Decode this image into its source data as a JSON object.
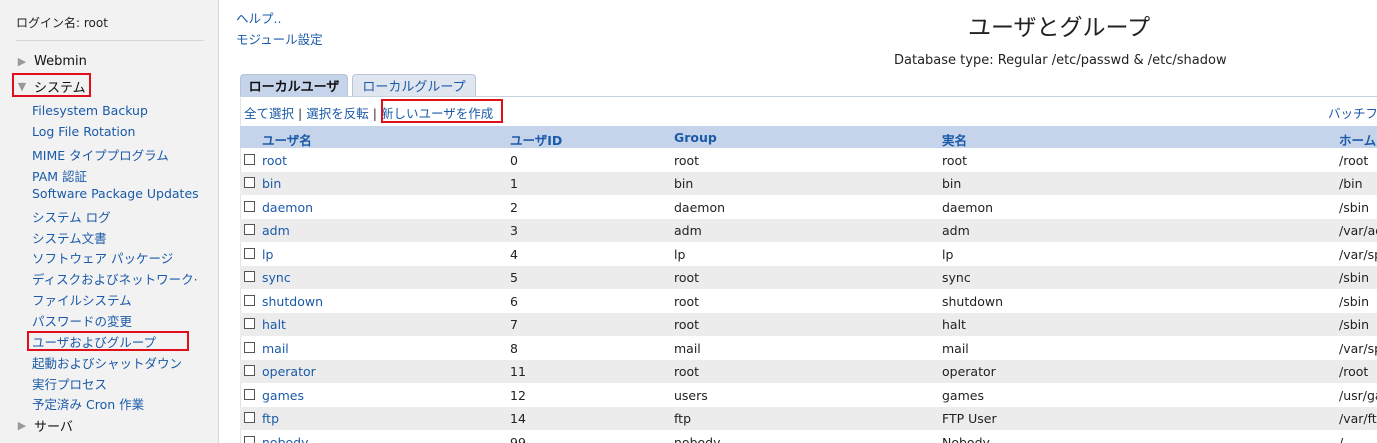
{
  "sidebar": {
    "login": "ログイン名: root",
    "categories": {
      "webmin": "Webmin",
      "system": "システム",
      "server": "サーバ"
    },
    "system_items": [
      "Filesystem Backup",
      "Log File Rotation",
      "MIME タイププログラム",
      "PAM 認証",
      "Software Package Updates",
      "システム ログ",
      "システム文書",
      "ソフトウェア パッケージ",
      "ディスクおよびネットワーク·",
      "ファイルシステム",
      "パスワードの変更",
      "ユーザおよびグループ",
      "起動およびシャットダウン",
      "実行プロセス",
      "予定済み Cron 作業"
    ]
  },
  "header": {
    "help": "ヘルプ..",
    "module_config": "モジュール設定",
    "title": "ユーザとグループ",
    "db_type": "Database type: Regular /etc/passwd & /etc/shadow"
  },
  "tabs": {
    "local_users": "ローカルユーザ",
    "local_groups": "ローカルグループ"
  },
  "actions": {
    "select_all": "全て選択",
    "invert": "選択を反転",
    "create": "新しいユーザを作成",
    "batch": "バッチフ"
  },
  "table": {
    "headers": {
      "name": "ユーザ名",
      "uid": "ユーザID",
      "group": "Group",
      "real": "実名",
      "home": "ホーム"
    },
    "rows": [
      {
        "name": "root",
        "uid": "0",
        "group": "root",
        "real": "root",
        "home": "/root"
      },
      {
        "name": "bin",
        "uid": "1",
        "group": "bin",
        "real": "bin",
        "home": "/bin"
      },
      {
        "name": "daemon",
        "uid": "2",
        "group": "daemon",
        "real": "daemon",
        "home": "/sbin"
      },
      {
        "name": "adm",
        "uid": "3",
        "group": "adm",
        "real": "adm",
        "home": "/var/ad"
      },
      {
        "name": "lp",
        "uid": "4",
        "group": "lp",
        "real": "lp",
        "home": "/var/sp"
      },
      {
        "name": "sync",
        "uid": "5",
        "group": "root",
        "real": "sync",
        "home": "/sbin"
      },
      {
        "name": "shutdown",
        "uid": "6",
        "group": "root",
        "real": "shutdown",
        "home": "/sbin"
      },
      {
        "name": "halt",
        "uid": "7",
        "group": "root",
        "real": "halt",
        "home": "/sbin"
      },
      {
        "name": "mail",
        "uid": "8",
        "group": "mail",
        "real": "mail",
        "home": "/var/sp"
      },
      {
        "name": "operator",
        "uid": "11",
        "group": "root",
        "real": "operator",
        "home": "/root"
      },
      {
        "name": "games",
        "uid": "12",
        "group": "users",
        "real": "games",
        "home": "/usr/ga"
      },
      {
        "name": "ftp",
        "uid": "14",
        "group": "ftp",
        "real": "FTP User",
        "home": "/var/ftp"
      },
      {
        "name": "nobody",
        "uid": "99",
        "group": "nobody",
        "real": "Nobody",
        "home": "/"
      }
    ]
  },
  "colors": {
    "link": "#1b5aa8",
    "header_bg": "#c5d4eb",
    "highlight": "#e0101a"
  }
}
